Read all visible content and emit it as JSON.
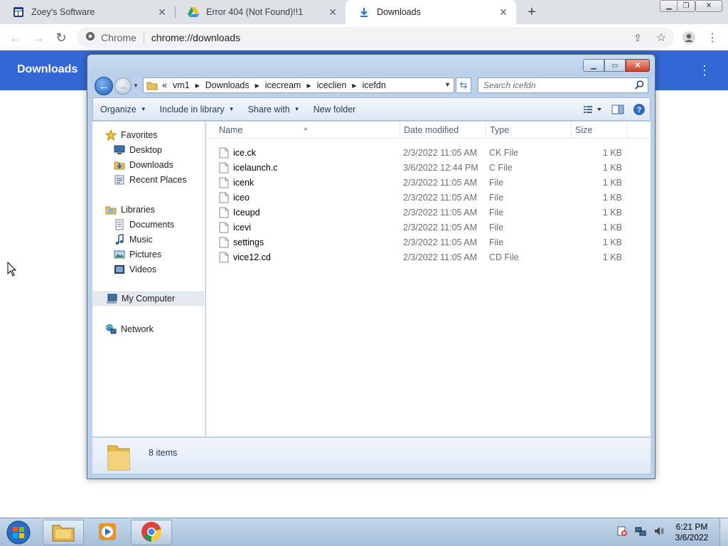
{
  "browser": {
    "tabs": [
      {
        "title": "Zoey's Software",
        "icon": "site-icon"
      },
      {
        "title": "Error 404 (Not Found)!!1",
        "icon": "drive-icon"
      },
      {
        "title": "Downloads",
        "icon": "download-icon",
        "active": true
      }
    ],
    "omnibox": {
      "chip": "Chrome",
      "url": "chrome://downloads"
    },
    "downloads_title": "Downloads",
    "accent": "#3367d6"
  },
  "explorer": {
    "breadcrumb": [
      "vm1",
      "Downloads",
      "icecream",
      "iceclien",
      "icefdn"
    ],
    "search_placeholder": "Search icefdn",
    "commands": [
      "Organize",
      "Include in library",
      "Share with",
      "New folder"
    ],
    "nav": {
      "favorites": {
        "label": "Favorites",
        "items": [
          "Desktop",
          "Downloads",
          "Recent Places"
        ]
      },
      "libraries": {
        "label": "Libraries",
        "items": [
          "Documents",
          "Music",
          "Pictures",
          "Videos"
        ]
      },
      "computer": "My Computer",
      "network": "Network"
    },
    "columns": [
      "Name",
      "Date modified",
      "Type",
      "Size"
    ],
    "files": [
      {
        "name": "ice.ck",
        "date": "2/3/2022 11:05 AM",
        "type": "CK File",
        "size": "1 KB"
      },
      {
        "name": "icelaunch.c",
        "date": "3/6/2022 12:44 PM",
        "type": "C File",
        "size": "1 KB"
      },
      {
        "name": "icenk",
        "date": "2/3/2022 11:05 AM",
        "type": "File",
        "size": "1 KB"
      },
      {
        "name": "iceo",
        "date": "2/3/2022 11:05 AM",
        "type": "File",
        "size": "1 KB"
      },
      {
        "name": "Iceupd",
        "date": "2/3/2022 11:05 AM",
        "type": "File",
        "size": "1 KB"
      },
      {
        "name": "icevi",
        "date": "2/3/2022 11:05 AM",
        "type": "File",
        "size": "1 KB"
      },
      {
        "name": "settings",
        "date": "2/3/2022 11:05 AM",
        "type": "File",
        "size": "1 KB"
      },
      {
        "name": "vice12.cd",
        "date": "2/3/2022 11:05 AM",
        "type": "CD File",
        "size": "1 KB"
      }
    ],
    "item_count": "8 items"
  },
  "taskbar": {
    "time": "6:21 PM",
    "date": "3/6/2022"
  }
}
